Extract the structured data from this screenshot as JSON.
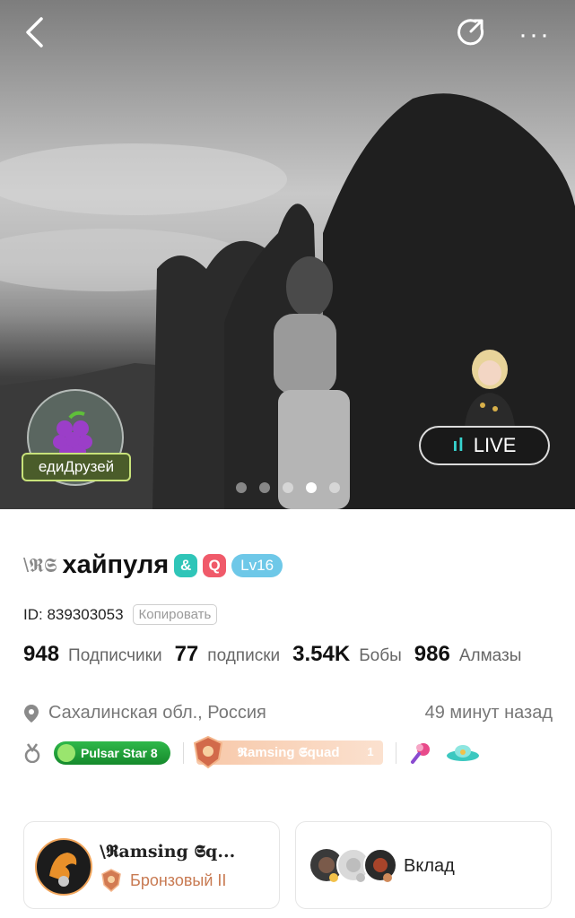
{
  "header": {
    "back_icon": "chevron-left-icon",
    "share_icon": "share-icon",
    "more_label": "···"
  },
  "cover": {
    "badge_label": "едиДрузей",
    "live_label": "LIVE",
    "live_icon": "ıl",
    "dots_count": 5,
    "active_dot": 3
  },
  "profile": {
    "wing_left": "\\𝕽𝕾",
    "name": "хайпуля",
    "level": "Lv16",
    "icon1": "&",
    "icon2": "Q",
    "id_text": "ID: 839303053",
    "copy_label": "Копировать"
  },
  "stats": [
    {
      "value": "948",
      "label": "Подписчики"
    },
    {
      "value": "77",
      "label": "подписки"
    },
    {
      "value": "3.54K",
      "label": "Бобы"
    },
    {
      "value": "986",
      "label": "Алмазы"
    }
  ],
  "location": {
    "place": "Сахалинская обл., Россия",
    "last_seen": "49 минут назад"
  },
  "badges": {
    "pulsar_label": "Pulsar Star 8",
    "squad_label": "𝕽amsing 𝕾quad",
    "squad_number": "1"
  },
  "cards": {
    "family_title": "\\𝕽amsing 𝕾q...",
    "family_rank": "Бронзовый II",
    "contribution_label": "Вклад"
  },
  "colors": {
    "accent_teal": "#37d4d0",
    "level_blue": "#6ec8e8",
    "pulsar_green": "#1fa13a",
    "rank_bronze": "#c87a52"
  }
}
